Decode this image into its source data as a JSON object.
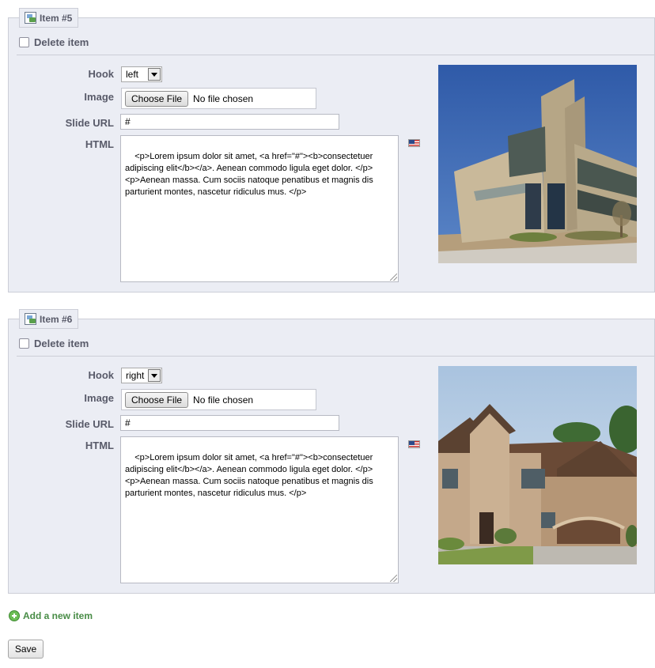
{
  "items": [
    {
      "legend": "Item #5",
      "delete_label": "Delete item",
      "hook_label": "Hook",
      "hook_value": "left",
      "image_label": "Image",
      "choose_file_label": "Choose File",
      "file_status": "No file chosen",
      "slide_url_label": "Slide URL",
      "slide_url_value": "#",
      "html_label": "HTML",
      "html_value": "<p>Lorem ipsum dolor sit amet, <a href=\"#\"><b>consectetuer adipiscing elit</b></a>. Aenean commodo ligula eget dolor. </p>\n<p>Aenean massa. Cum sociis natoque penatibus et magnis dis parturient montes, nascetur ridiculus mus. </p>",
      "language_flag": "us-flag-icon",
      "thumbnail": "commercial-building-photo"
    },
    {
      "legend": "Item #6",
      "delete_label": "Delete item",
      "hook_label": "Hook",
      "hook_value": "right",
      "image_label": "Image",
      "choose_file_label": "Choose File",
      "file_status": "No file chosen",
      "slide_url_label": "Slide URL",
      "slide_url_value": "#",
      "html_label": "HTML",
      "html_value": "<p>Lorem ipsum dolor sit amet, <a href=\"#\"><b>consectetuer adipiscing elit</b></a>. Aenean commodo ligula eget dolor. </p>\n<p>Aenean massa. Cum sociis natoque penatibus et magnis dis parturient montes, nascetur ridiculus mus. </p>",
      "language_flag": "us-flag-icon",
      "thumbnail": "suburban-house-photo"
    }
  ],
  "add_item_label": "Add a new item",
  "save_label": "Save",
  "colors": {
    "panel_bg": "#ebedf4",
    "panel_border": "#ccced7",
    "label_text": "#585a69",
    "link_green": "#488c46"
  }
}
